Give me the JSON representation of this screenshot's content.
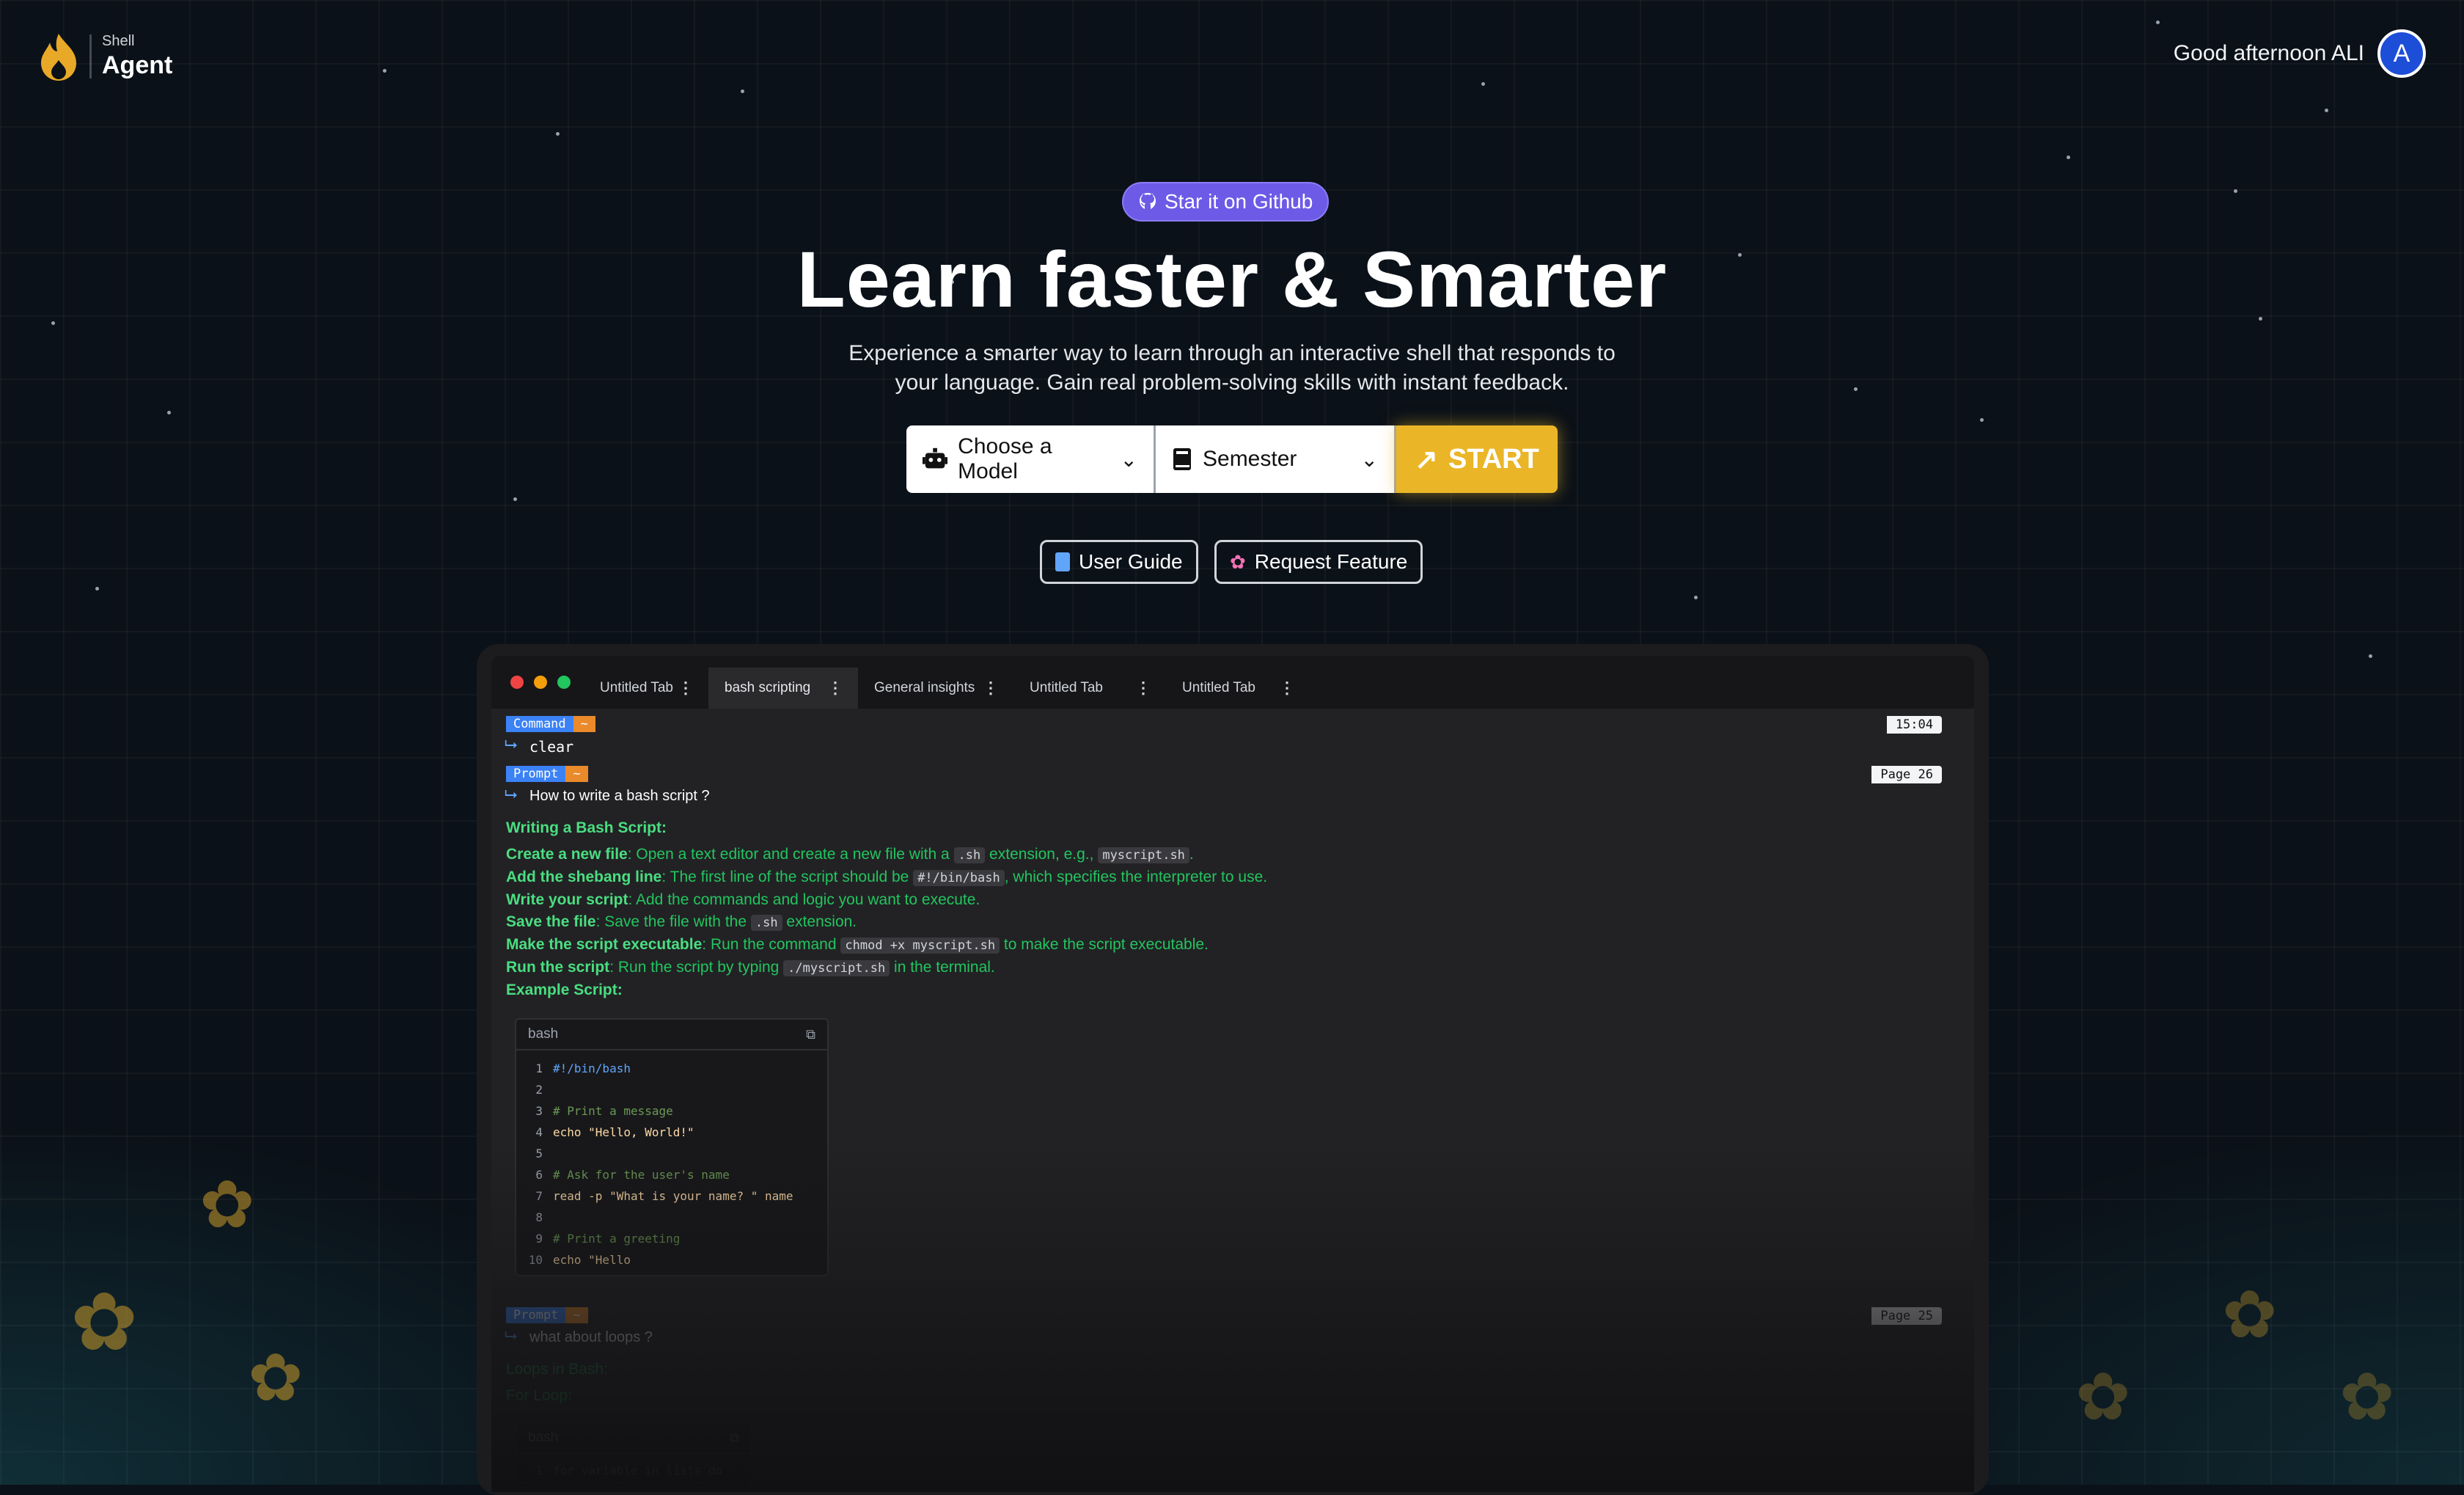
{
  "header": {
    "brand_small": "Shell",
    "brand_big": "Agent",
    "greeting": "Good afternoon ALI",
    "avatar_initial": "A"
  },
  "hero": {
    "badge": "Star it on Github",
    "title": "Learn faster & Smarter",
    "subtitle": "Experience a smarter way to learn through an interactive shell that responds to your language. Gain real problem-solving skills with instant feedback.",
    "model_select": "Choose a Model",
    "semester_select": "Semester",
    "start_label": "START",
    "user_guide": "User Guide",
    "request_feature": "Request Feature"
  },
  "terminal": {
    "tabs": [
      {
        "label": "Untitled Tab"
      },
      {
        "label": "bash scripting"
      },
      {
        "label": "General insights"
      },
      {
        "label": "Untitled Tab"
      },
      {
        "label": "Untitled Tab"
      }
    ],
    "entry1": {
      "tag": "Command",
      "dir": "~",
      "text": "clear",
      "badge": "15:04"
    },
    "entry2": {
      "tag": "Prompt",
      "dir": "~",
      "text": "How to write a bash script ?",
      "badge": "Page 26"
    },
    "answer": {
      "heading": "Writing a Bash Script:",
      "l1_b": "Create a new file",
      "l1_t1": ": Open a text editor and create a new file with a ",
      "l1_c1": ".sh",
      "l1_t2": " extension, e.g., ",
      "l1_c2": "myscript.sh",
      "l1_t3": ".",
      "l2_b": "Add the shebang line",
      "l2_t1": ": The first line of the script should be ",
      "l2_c1": "#!/bin/bash",
      "l2_t2": ", which specifies the interpreter to use.",
      "l3_b": "Write your script",
      "l3_t1": ": Add the commands and logic you want to execute.",
      "l4_b": "Save the file",
      "l4_t1": ": Save the file with the ",
      "l4_c1": ".sh",
      "l4_t2": " extension.",
      "l5_b": "Make the script executable",
      "l5_t1": ": Run the command ",
      "l5_c1": "chmod +x myscript.sh",
      "l5_t2": " to make the script executable.",
      "l6_b": "Run the script",
      "l6_t1": ": Run the script by typing ",
      "l6_c1": "./myscript.sh",
      "l6_t2": " in the terminal.",
      "example": "Example Script:"
    },
    "code": {
      "lang": "bash",
      "lines": [
        {
          "n": "1",
          "t": "#!/bin/bash"
        },
        {
          "n": "2",
          "t": ""
        },
        {
          "n": "3",
          "t": "# Print a message"
        },
        {
          "n": "4",
          "t": "echo \"Hello, World!\""
        },
        {
          "n": "5",
          "t": ""
        },
        {
          "n": "6",
          "t": "# Ask for the user's name"
        },
        {
          "n": "7",
          "t": "read -p \"What is your name? \" name"
        },
        {
          "n": "8",
          "t": ""
        },
        {
          "n": "9",
          "t": "# Print a greeting"
        },
        {
          "n": "10",
          "t": "echo \"Hello"
        }
      ]
    },
    "entry3": {
      "tag": "Prompt",
      "dir": "~",
      "text": "what about loops ?",
      "badge": "Page 25"
    },
    "answer2": {
      "heading": "Loops in Bash:",
      "sub": "For Loop:"
    },
    "code2": {
      "lang": "bash",
      "line1_n": "1",
      "line1_t": "for variable in lists do"
    }
  }
}
